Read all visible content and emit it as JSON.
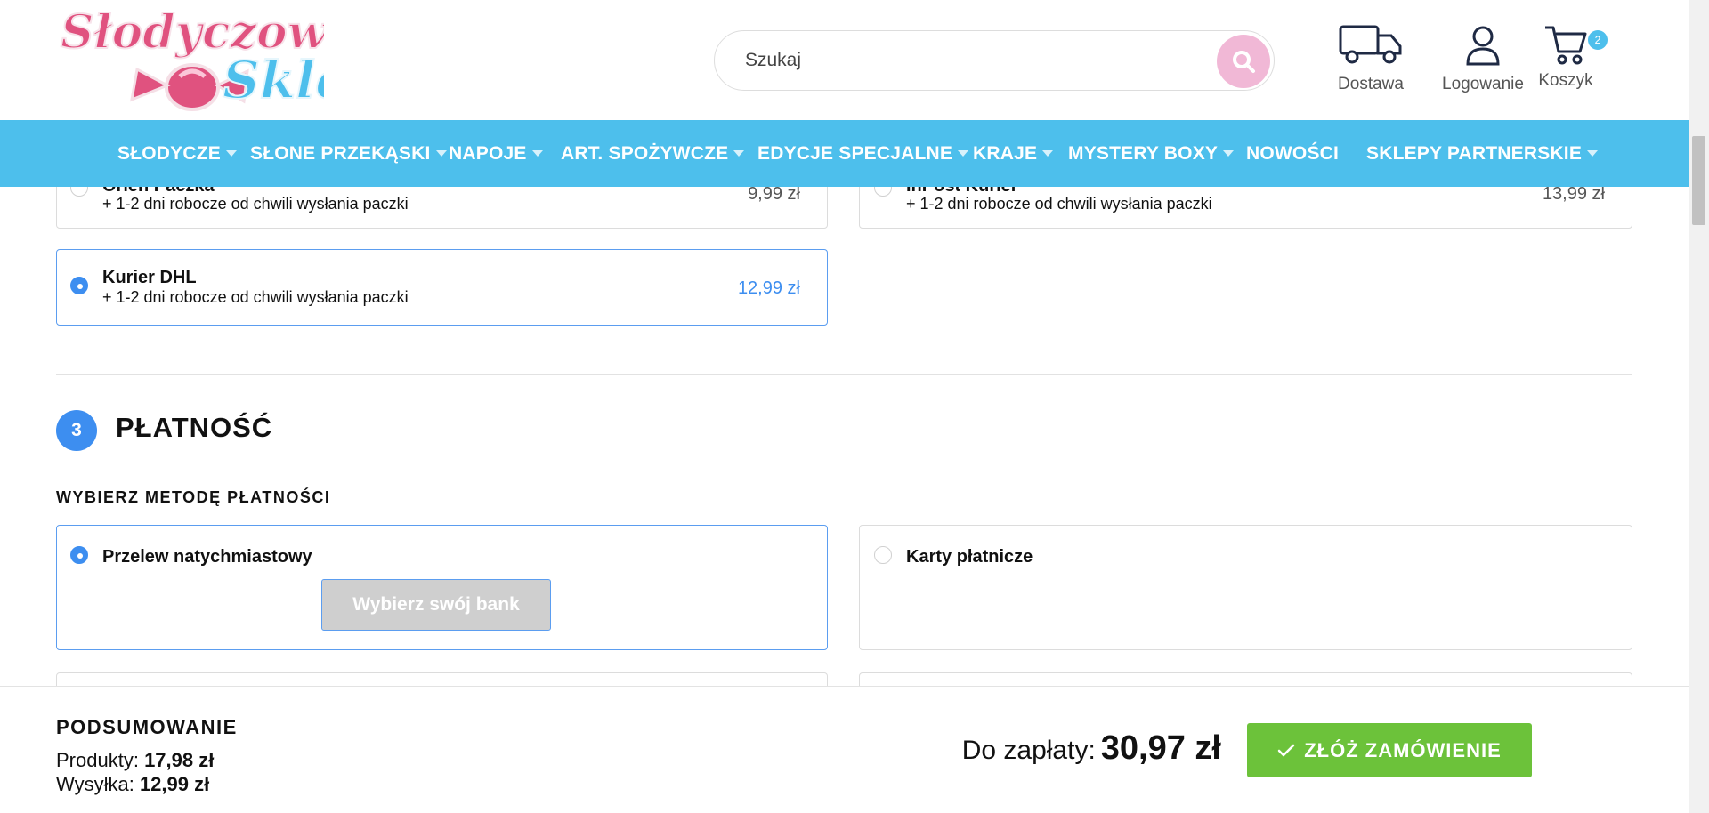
{
  "header": {
    "logo_line1": "Słodyczowo",
    "logo_line2": "Sklep",
    "search_placeholder": "Szukaj",
    "delivery_label": "Dostawa",
    "login_label": "Logowanie",
    "cart_label": "Koszyk",
    "cart_count": "2"
  },
  "nav": {
    "items": [
      {
        "label": "SŁODYCZE"
      },
      {
        "label": "SŁONE PRZEKĄSKI"
      },
      {
        "label": "NAPOJE"
      },
      {
        "label": "ART. SPOŻYWCZE"
      },
      {
        "label": "EDYCJE SPECJALNE"
      },
      {
        "label": "KRAJE"
      },
      {
        "label": "MYSTERY BOXY"
      },
      {
        "label": "NOWOŚCI"
      },
      {
        "label": "SKLEPY PARTNERSKIE"
      }
    ]
  },
  "shipping": {
    "options": [
      {
        "title": "Orlen Paczka",
        "subtitle": "+ 1-2 dni robocze od chwili wysłania paczki",
        "price": "9,99 zł",
        "selected": false
      },
      {
        "title": "InPost Kurier",
        "subtitle": "+ 1-2 dni robocze od chwili wysłania paczki",
        "price": "13,99 zł",
        "selected": false
      },
      {
        "title": "Kurier DHL",
        "subtitle": "+ 1-2 dni robocze od chwili wysłania paczki",
        "price": "12,99 zł",
        "selected": true
      }
    ]
  },
  "payment": {
    "step_number": "3",
    "step_title": "PŁATNOŚĆ",
    "section_label": "WYBIERZ METODĘ PŁATNOŚCI",
    "methods": [
      {
        "label": "Przelew natychmiastowy",
        "selected": true
      },
      {
        "label": "Karty płatnicze",
        "selected": false
      }
    ],
    "bank_button": "Wybierz swój bank"
  },
  "summary": {
    "title": "PODSUMOWANIE",
    "products_label": "Produkty:",
    "products_value": "17,98 zł",
    "shipping_label": "Wysyłka:",
    "shipping_value": "12,99 zł",
    "total_label": "Do zapłaty:",
    "total_value": "30,97 zł",
    "order_button": "ZŁÓŻ ZAMÓWIENIE"
  },
  "colors": {
    "brand_blue": "#4dbfec",
    "accent_blue": "#3d8ef0",
    "order_green": "#6cc23a",
    "logo_pink": "#e0527f"
  }
}
